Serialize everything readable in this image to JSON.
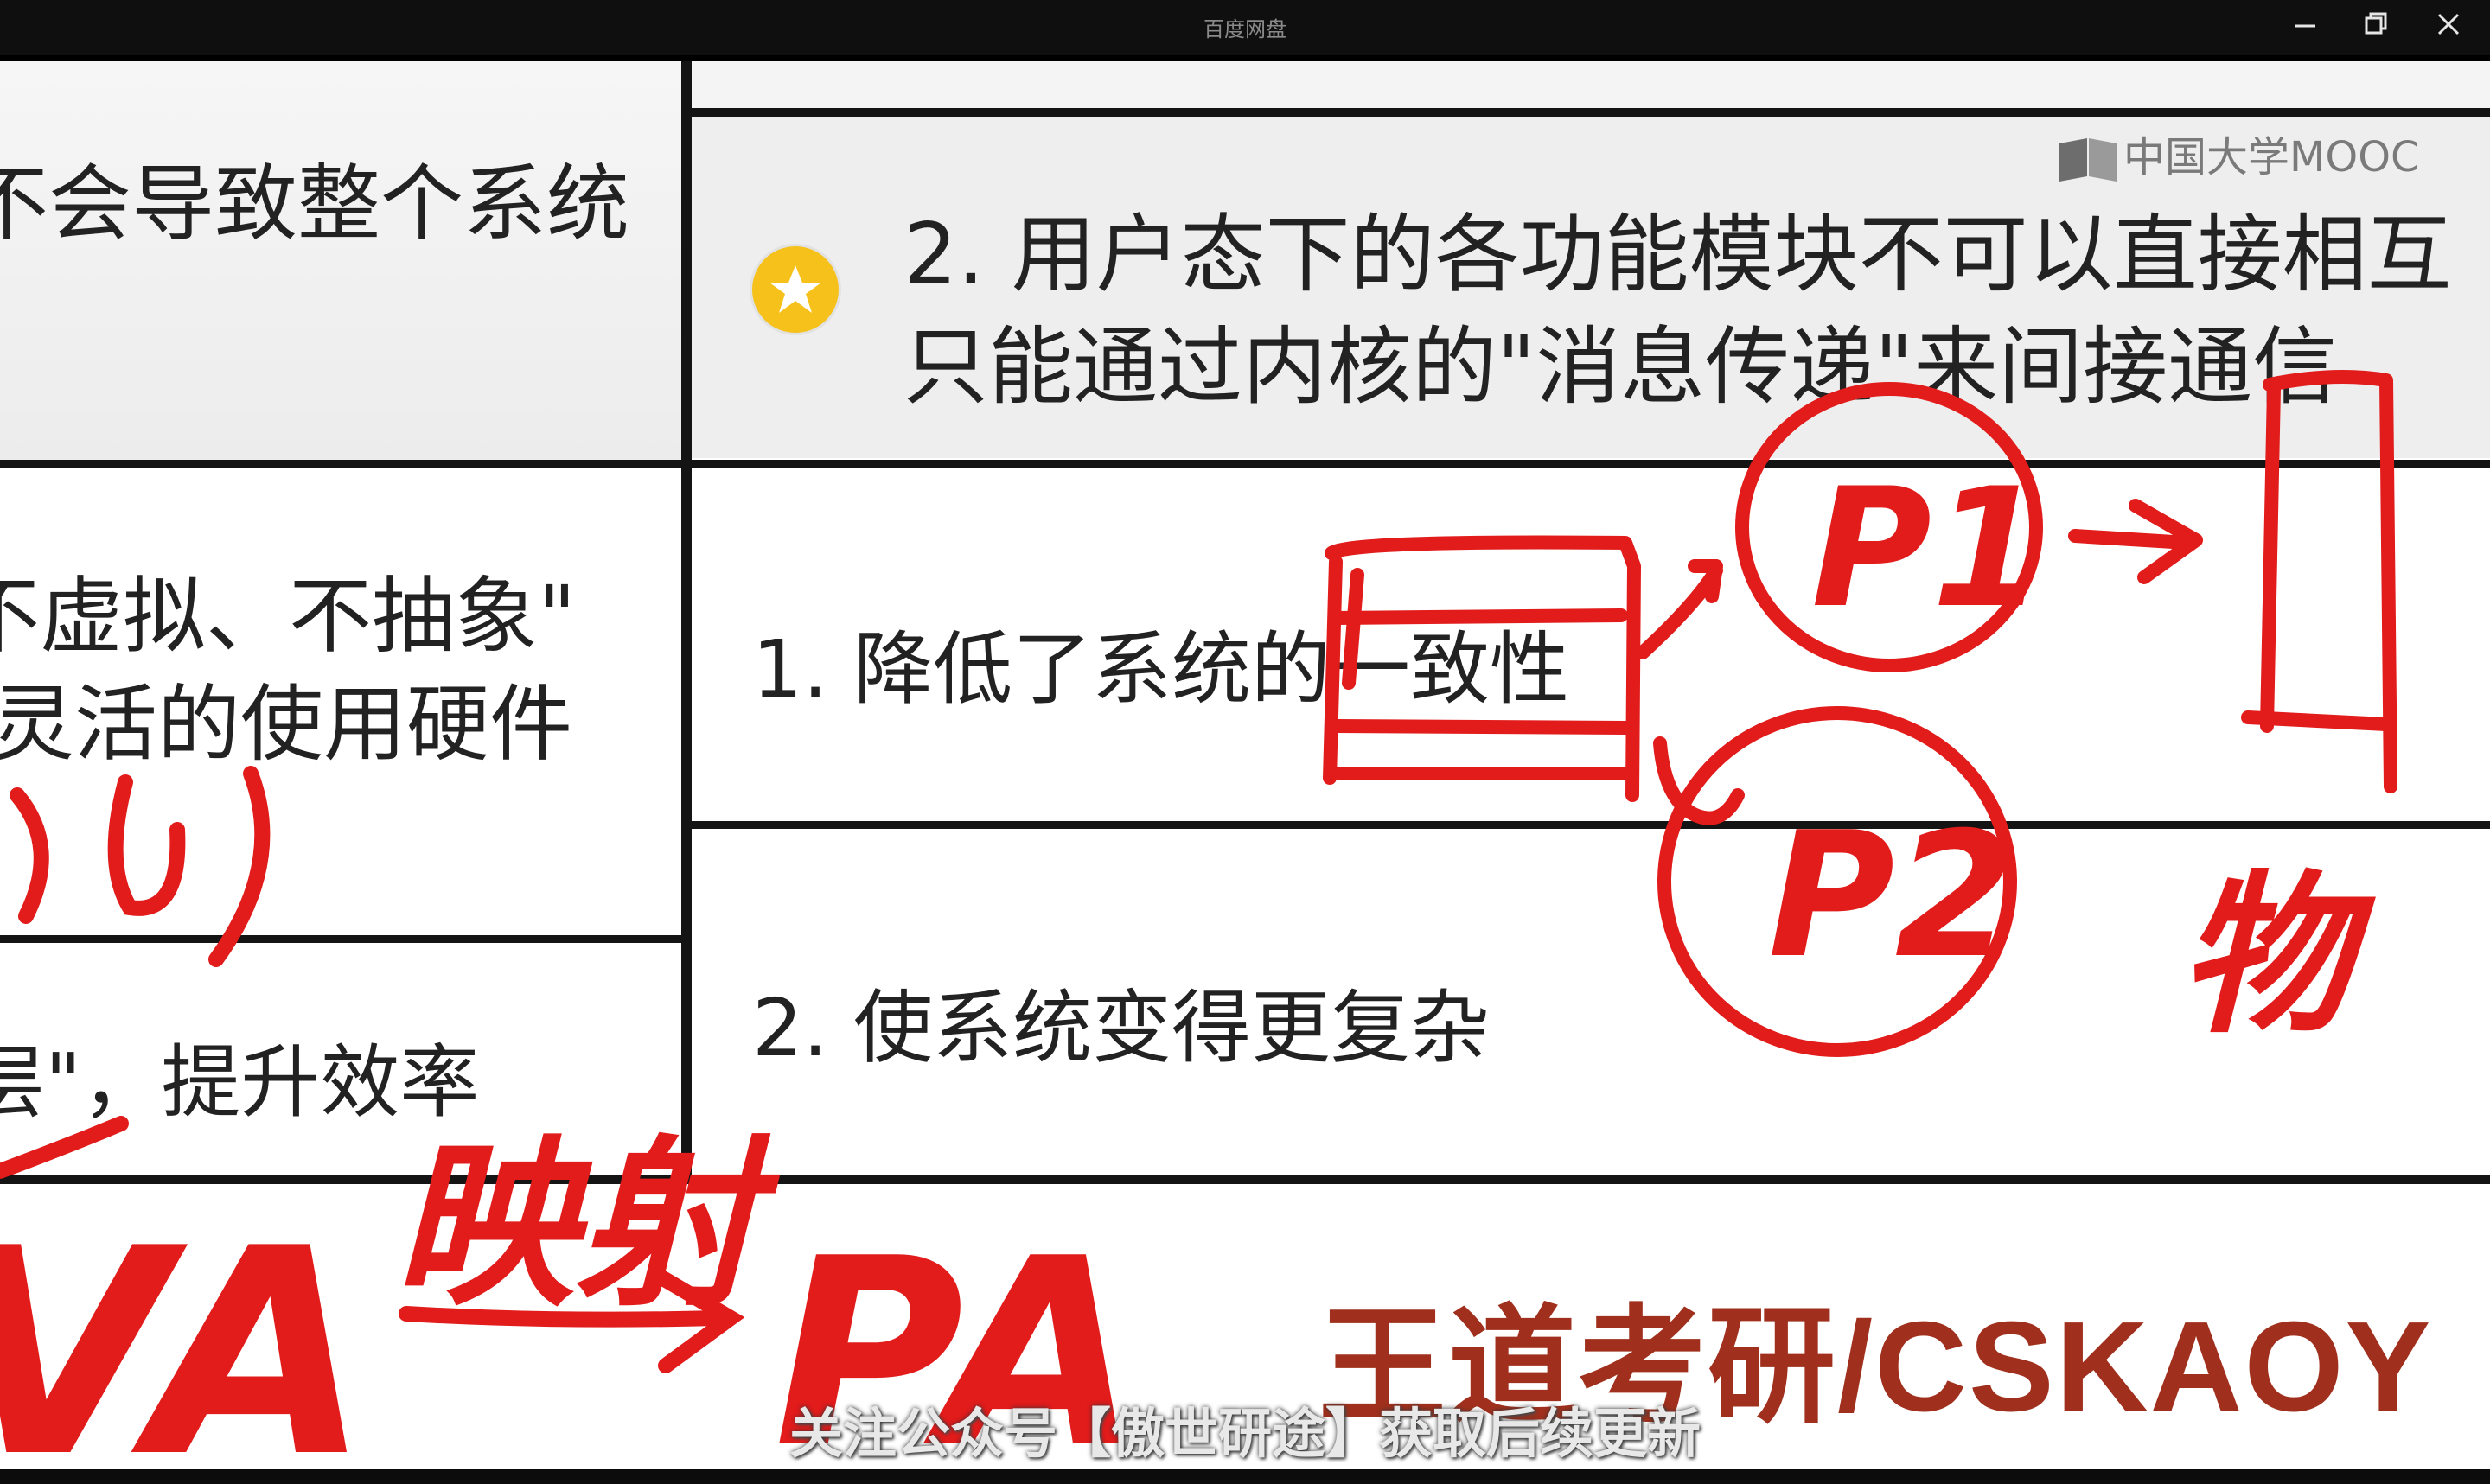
{
  "window": {
    "title": "百度网盘",
    "minimize_icon": "minimize-icon",
    "restore_icon": "restore-icon",
    "close_icon": "close-icon"
  },
  "slide": {
    "left_col": {
      "row1": "不会导致整个系统",
      "row2_line1": "不虚拟、不抽象\"",
      "row2_line2": "灵活的使用硬件",
      "row3": "层\"，提升效率"
    },
    "right_col": {
      "header_line1": "2.  用户态下的各功能模块不可以直接相互",
      "header_line2": "只能通过内核的\"消息传递\"来间接通信",
      "item1": "1. 降低了系统的一致性",
      "item2": "2. 使系统变得更复杂"
    },
    "logo_text": "中国大学MOOC",
    "brand_text": "王道考研/CSKAOY"
  },
  "annotations": {
    "p1": "P1",
    "p2": "P2",
    "va": "VA",
    "pa": "PA",
    "mapping": "映射",
    "physical": "物"
  },
  "subtitle": "关注公众号【傲世研途】获取后续更新",
  "colors": {
    "ink": "#e21b1b",
    "brand": "#a0301d",
    "star": "#f5c11a"
  }
}
